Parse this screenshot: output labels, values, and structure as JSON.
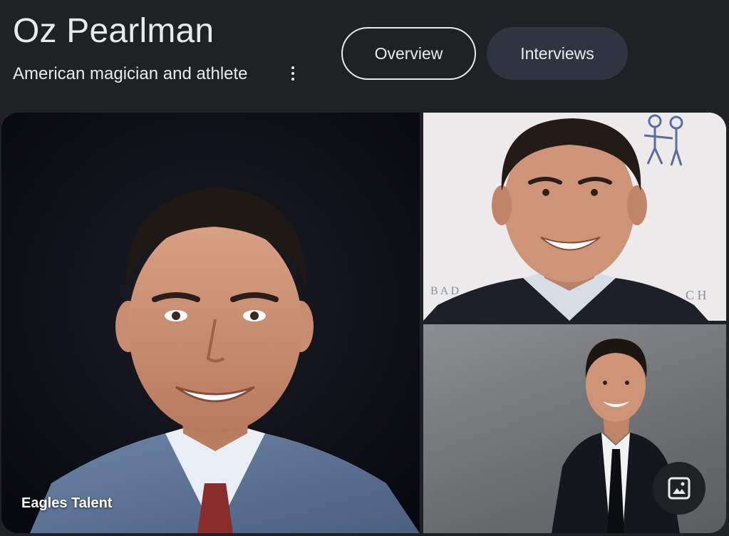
{
  "entity": {
    "title": "Oz Pearlman",
    "subtitle": "American magician and athlete"
  },
  "menu": {
    "icon": "more-vert-icon"
  },
  "tabs": [
    {
      "label": "Overview",
      "selected": true
    },
    {
      "label": "Interviews",
      "selected": false
    }
  ],
  "gallery": {
    "main_image_source": "Eagles Talent",
    "image_search_icon": "image-icon"
  },
  "colors": {
    "background": "#202124",
    "text": "#e8eaed",
    "tab_unselected_bg": "#303440"
  }
}
